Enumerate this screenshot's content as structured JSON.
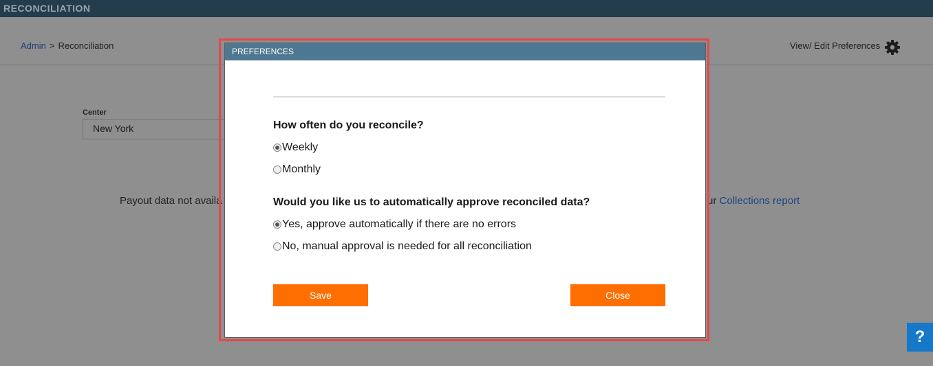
{
  "app": {
    "title": "RECONCILIATION"
  },
  "breadcrumb": {
    "parent": "Admin",
    "separator": ">",
    "current": "Reconciliation"
  },
  "header": {
    "preferences_link": "View/ Edit Preferences"
  },
  "filters": {
    "center_label": "Center",
    "center_value": "New York"
  },
  "main": {
    "message_start": "Payout data not availa",
    "message_end": "ur",
    "collections_link": "Collections report"
  },
  "modal": {
    "title": "PREFERENCES",
    "q1": "How often do you reconcile?",
    "q1_options": [
      "Weekly",
      "Monthly"
    ],
    "q1_selected": "Weekly",
    "q2": "Would you like us to automatically approve reconciled data?",
    "q2_options": [
      "Yes, approve automatically if there are no errors",
      "No, manual approval is needed for all reconciliation"
    ],
    "q2_selected": "Yes, approve automatically if there are no errors",
    "save_label": "Save",
    "close_label": "Close"
  },
  "help": {
    "label": "?"
  },
  "colors": {
    "topbar": "#233d4c",
    "modal_header": "#4e7792",
    "button": "#ff6e00",
    "link": "#1f3f76",
    "help": "#1578c8",
    "highlight": "#e5474b"
  },
  "icons": {
    "settings": "gear-icon",
    "help": "question-icon"
  }
}
